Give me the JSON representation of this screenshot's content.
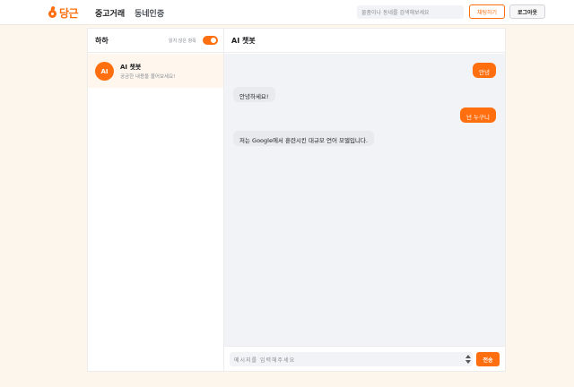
{
  "header": {
    "logo_text": "당근",
    "nav": {
      "used_trade": "중고거래",
      "town_auth": "동네인증"
    },
    "search": {
      "placeholder": "물품이나 동네를 검색해보세요"
    },
    "chat_button": "채팅하기",
    "logout_button": "로그아웃"
  },
  "chat_list": {
    "title": "하하",
    "unread_only_label": "읽지 않은 항목",
    "unread_only_on": true,
    "rooms": [
      {
        "avatar": "AI",
        "name": "AI 챗봇",
        "preview": "궁금한 내용을 물어보세요!"
      }
    ]
  },
  "conversation": {
    "title": "AI 챗봇",
    "messages": [
      {
        "from": "me",
        "text": "안녕"
      },
      {
        "from": "bot",
        "text": "안녕하세요!"
      },
      {
        "from": "me",
        "text": "넌 누구니"
      },
      {
        "from": "bot",
        "text": "저는 Google에서 훈련시킨 대규모 언어 모델입니다."
      }
    ],
    "input_placeholder": "메시지를 입력해주세요",
    "send_button": "전송"
  },
  "colors": {
    "accent": "#ff6f0f",
    "background": "#fdf6ec"
  }
}
